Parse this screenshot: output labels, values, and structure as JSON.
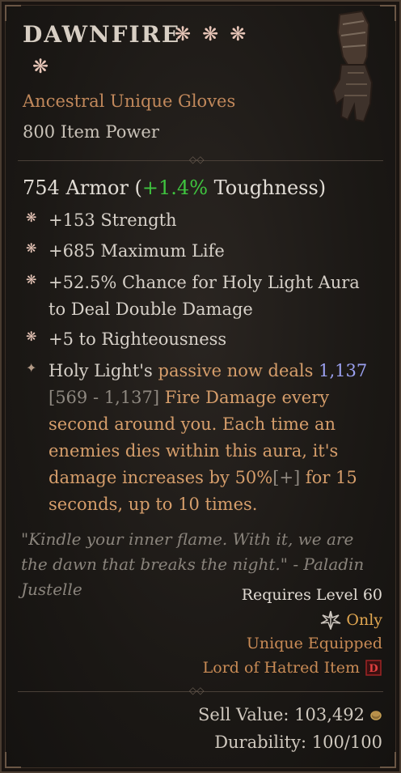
{
  "item": {
    "name": "DAWNFIRE",
    "type_line": "Ancestral Unique Gloves",
    "item_power": "800 Item Power",
    "icon": "gauntlet-image",
    "stars": [
      "❋",
      "❋",
      "❋",
      "❋"
    ]
  },
  "armor": {
    "value": "754 Armor (",
    "toughness_delta": "+1.4%",
    "toughness_label": " Toughness)"
  },
  "affixes": [
    {
      "icon": "star-bullet-icon",
      "text": "+153 Strength"
    },
    {
      "icon": "star-bullet-icon",
      "text": "+685 Maximum Life"
    },
    {
      "icon": "star-bullet-icon",
      "text": "+52.5% Chance for Holy Light Aura to Deal Double Damage"
    },
    {
      "icon": "star-bullet-icon",
      "text": "+5 to Righteousness"
    }
  ],
  "unique_power": {
    "icon": "unique-power-icon",
    "part1": "Holy Light's ",
    "part2": "passive now deals ",
    "value": "1,137",
    "range": "[569 - 1,137]",
    "part3": " Fire Damage every second around you. Each time an enemies dies within this aura, it's damage increases by 50%",
    "plus": "[+]",
    "part4": " for 15 seconds, up to 10 times."
  },
  "flavor": "\"Kindle your inner flame. With it, we are the dawn that breaks the night.\" - Paladin Justelle",
  "requirements": {
    "level": "Requires Level 60",
    "class_only": "Only",
    "class_icon": "paladin-class-icon",
    "unique_equipped": "Unique Equipped",
    "expansion": "Lord of Hatred Item",
    "expansion_icon": "lord-of-hatred-icon"
  },
  "footer": {
    "sell_label": "Sell Value: 103,492",
    "gold_icon": "gold-coin-icon",
    "durability": "Durability: 100/100"
  }
}
